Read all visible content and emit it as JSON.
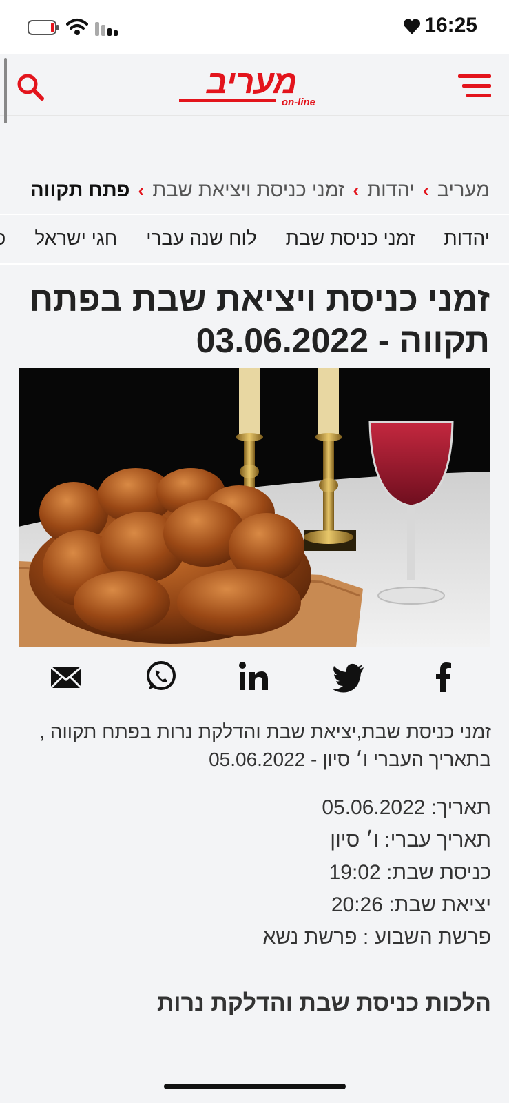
{
  "status_bar": {
    "time": "16:25"
  },
  "header": {
    "logo_text": "מעריב",
    "logo_subtext": "on-line"
  },
  "breadcrumb": [
    {
      "label": "מעריב"
    },
    {
      "label": "יהדות"
    },
    {
      "label": "זמני כניסת ויציאת שבת"
    },
    {
      "label": "פתח תקווה"
    }
  ],
  "category_nav": [
    {
      "label": "יהדות"
    },
    {
      "label": "זמני כניסת שבת"
    },
    {
      "label": "לוח שנה עברי"
    },
    {
      "label": "חגי ישראל"
    },
    {
      "label": "פרשת השבוע"
    }
  ],
  "article": {
    "title": "זמני כניסת ויציאת שבת בפתח תקווה - 03.06.2022",
    "summary": "זמני כניסת שבת,יציאת שבת והדלקת נרות בפתח תקווה , בתאריך העברי ו׳ סיון - 05.06.2022",
    "details": [
      {
        "label": "תאריך:",
        "value": "05.06.2022"
      },
      {
        "label": "תאריך עברי:",
        "value": "ו׳ סיון"
      },
      {
        "label": "כניסת שבת:",
        "value": "19:02"
      },
      {
        "label": "יציאת שבת:",
        "value": "20:26"
      },
      {
        "label": "פרשת השבוע :",
        "value": "פרשת נשא"
      }
    ],
    "section_heading": "הלכות כניסת שבת והדלקת נרות"
  },
  "share_icons": [
    "facebook-icon",
    "twitter-icon",
    "linkedin-icon",
    "whatsapp-icon",
    "email-icon"
  ],
  "colors": {
    "brand": "#e3141c",
    "background": "#f3f4f6"
  }
}
